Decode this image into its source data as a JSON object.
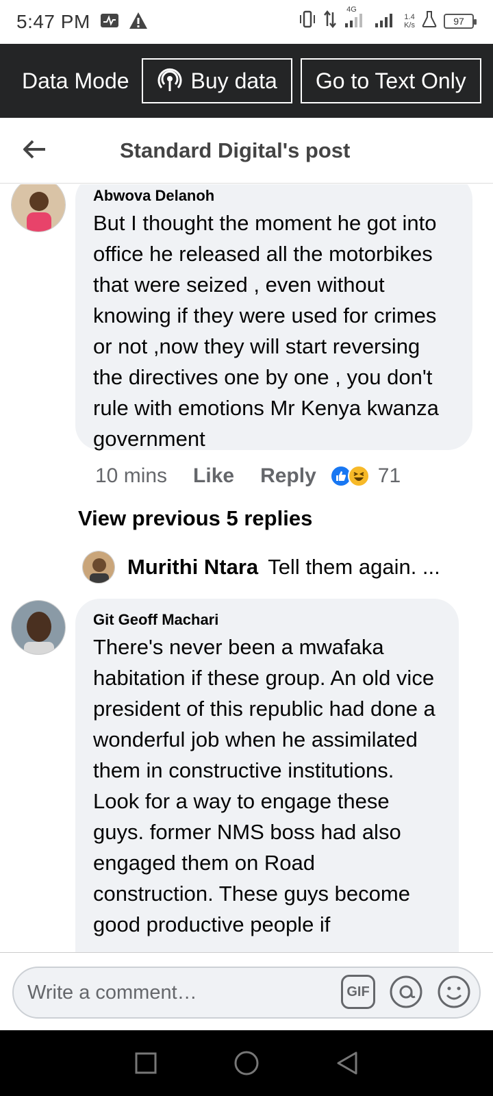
{
  "status_bar": {
    "time": "5:47 PM",
    "network_type": "4G",
    "speed_value": "1.4",
    "speed_unit": "K/s",
    "battery": "97"
  },
  "data_bar": {
    "mode_label": "Data Mode",
    "buy_data_label": "Buy data",
    "text_only_label": "Go to Text Only"
  },
  "header": {
    "title": "Standard Digital's post"
  },
  "comments": [
    {
      "author": "Abwova Delanoh",
      "text": "But I thought the moment he got into office he released all the motorbikes that were seized , even without knowing if they were used for crimes or not ,now they will start reversing the directives one by one , you don't rule with emotions Mr Kenya kwanza government",
      "time": "10 mins",
      "like_label": "Like",
      "reply_label": "Reply",
      "reaction_count": "71",
      "view_previous": "View previous 5 replies",
      "latest_reply": {
        "author": "Murithi Ntara",
        "text": "Tell them again. ..."
      }
    },
    {
      "author": "Git Geoff Machari",
      "text": "There's never been a mwafaka habitation if these group. An old vice president of this republic had done a wonderful job when he assimilated them in constructive institutions. Look for a way to engage these guys. former NMS boss had also engaged them on Road construction. These guys become good productive people  if"
    }
  ],
  "composer": {
    "placeholder": "Write a comment…",
    "gif_label": "GIF"
  },
  "colors": {
    "data_bar_bg": "#242526",
    "bubble_bg": "#f0f2f5",
    "like_blue": "#1877f2",
    "haha_yellow": "#f7b928"
  }
}
